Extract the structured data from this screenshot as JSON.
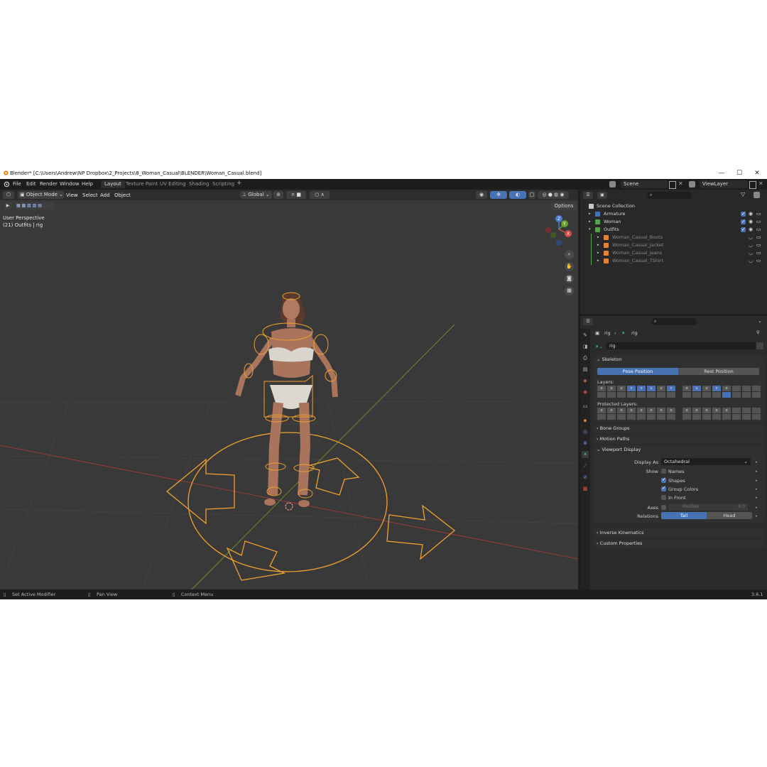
{
  "window": {
    "title": "Blender* [C:\\Users\\Andrew\\NP Dropbox\\2_Projects\\8_Woman_Casual\\BLENDER\\Woman_Casual.blend]",
    "controls": [
      "—",
      "☐",
      "✕"
    ]
  },
  "menu": [
    "File",
    "Edit",
    "Render",
    "Window",
    "Help"
  ],
  "workspaces": [
    "Layout",
    "Texture Paint",
    "UV Editing",
    "Shading",
    "Scripting"
  ],
  "active_workspace": "Layout",
  "scene": "Scene",
  "view_layer": "ViewLayer",
  "viewport": {
    "mode": "Object Mode",
    "menus": [
      "View",
      "Select",
      "Add",
      "Object"
    ],
    "transform_orientation": "Global",
    "options_label": "Options",
    "overlay_line1": "User Perspective",
    "overlay_line2": "(21) Outfits | rig",
    "gizmo": {
      "x": "X",
      "y": "Y",
      "z": "Z"
    }
  },
  "outliner": {
    "root": "Scene Collection",
    "items": [
      {
        "label": "Armature",
        "level": 1,
        "color": "#4772b3"
      },
      {
        "label": "Woman",
        "level": 1,
        "color": "#55a34f"
      },
      {
        "label": "Outfits",
        "level": 1,
        "color": "#55a34f"
      },
      {
        "label": "Woman_Casual_Boots",
        "level": 2,
        "color": "#e2833a"
      },
      {
        "label": "Woman_Casual_Jacket",
        "level": 2,
        "color": "#e2833a"
      },
      {
        "label": "Woman_Casual_Jeans",
        "level": 2,
        "color": "#e2833a"
      },
      {
        "label": "Woman_Casual_TShirt",
        "level": 2,
        "color": "#e2833a"
      }
    ]
  },
  "properties": {
    "breadcrumb": [
      "rig",
      "rig"
    ],
    "data_name": "rig",
    "skeleton": {
      "header": "Skeleton",
      "pose_position": "Pose Position",
      "rest_position": "Rest Position",
      "layers_label": "Layers:",
      "protected_label": "Protected Layers:"
    },
    "bone_groups": "Bone Groups",
    "motion_paths": "Motion Paths",
    "viewport_display": {
      "header": "Viewport Display",
      "display_as_label": "Display As",
      "display_as_value": "Octahedral",
      "show_label": "Show",
      "names": "Names",
      "shapes": "Shapes",
      "group_colors": "Group Colors",
      "in_front": "In Front",
      "axes_label": "Axes",
      "position_label": "Position",
      "position_value": "0.0",
      "relations_label": "Relations",
      "tail": "Tail",
      "head": "Head"
    },
    "inverse_kinematics": "Inverse Kinematics",
    "custom_properties": "Custom Properties"
  },
  "statusbar": {
    "left": "Set Active Modifier",
    "middle": "Pan View",
    "right": "Context Menu",
    "version": "3.6.1"
  },
  "colors": {
    "accent": "#4772b3",
    "rig": "#f0a030",
    "bg": "#393939"
  }
}
